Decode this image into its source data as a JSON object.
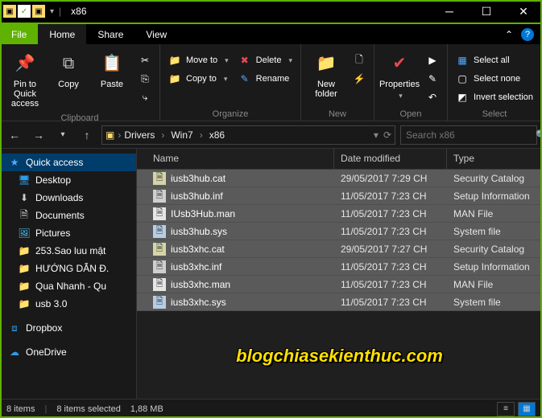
{
  "window": {
    "title": "x86"
  },
  "tabs": {
    "file": "File",
    "home": "Home",
    "share": "Share",
    "view": "View"
  },
  "ribbon": {
    "clipboard": {
      "pin": "Pin to Quick access",
      "copy": "Copy",
      "paste": "Paste",
      "label": "Clipboard"
    },
    "organize": {
      "moveto": "Move to",
      "copyto": "Copy to",
      "delete": "Delete",
      "rename": "Rename",
      "label": "Organize"
    },
    "new": {
      "folder": "New folder",
      "label": "New"
    },
    "open": {
      "properties": "Properties",
      "label": "Open"
    },
    "select": {
      "all": "Select all",
      "none": "Select none",
      "invert": "Invert selection",
      "label": "Select"
    }
  },
  "breadcrumb": [
    "Drivers",
    "Win7",
    "x86"
  ],
  "search": {
    "placeholder": "Search x86"
  },
  "columns": {
    "name": "Name",
    "date": "Date modified",
    "type": "Type"
  },
  "sidebar": [
    {
      "label": "Quick access",
      "icon": "star",
      "color": "#55aaff",
      "class": "quick top"
    },
    {
      "label": "Desktop",
      "icon": "desktop",
      "color": "#2f9be8"
    },
    {
      "label": "Downloads",
      "icon": "download",
      "color": "#cfcfcf"
    },
    {
      "label": "Documents",
      "icon": "doc",
      "color": "#e6e6e6"
    },
    {
      "label": "Pictures",
      "icon": "pic",
      "color": "#4fc3f7"
    },
    {
      "label": "253.Sao luu mật",
      "icon": "folder",
      "color": "#ffd96b"
    },
    {
      "label": "HƯỚNG DẪN Đ.",
      "icon": "folder",
      "color": "#ffd96b"
    },
    {
      "label": "Qua Nhanh - Qu",
      "icon": "folder",
      "color": "#ffd96b"
    },
    {
      "label": "usb 3.0",
      "icon": "folder",
      "color": "#ffd96b"
    },
    {
      "label": "Dropbox",
      "icon": "dropbox",
      "color": "#2f9be8",
      "class": "top",
      "gap": true
    },
    {
      "label": "OneDrive",
      "icon": "cloud",
      "color": "#2f9be8",
      "class": "top",
      "gap": true
    }
  ],
  "files": [
    {
      "name": "iusb3hub.cat",
      "date": "29/05/2017 7:29 CH",
      "type": "Security Catalog",
      "icon": "cat"
    },
    {
      "name": "iusb3hub.inf",
      "date": "11/05/2017 7:23 CH",
      "type": "Setup Information",
      "icon": "inf"
    },
    {
      "name": "IUsb3Hub.man",
      "date": "11/05/2017 7:23 CH",
      "type": "MAN File",
      "icon": "man"
    },
    {
      "name": "iusb3hub.sys",
      "date": "11/05/2017 7:23 CH",
      "type": "System file",
      "icon": "sys"
    },
    {
      "name": "iusb3xhc.cat",
      "date": "29/05/2017 7:27 CH",
      "type": "Security Catalog",
      "icon": "cat"
    },
    {
      "name": "iusb3xhc.inf",
      "date": "11/05/2017 7:23 CH",
      "type": "Setup Information",
      "icon": "inf"
    },
    {
      "name": "iusb3xhc.man",
      "date": "11/05/2017 7:23 CH",
      "type": "MAN File",
      "icon": "man"
    },
    {
      "name": "iusb3xhc.sys",
      "date": "11/05/2017 7:23 CH",
      "type": "System file",
      "icon": "sys"
    }
  ],
  "status": {
    "items": "8 items",
    "selected": "8 items selected",
    "size": "1,88 MB"
  },
  "watermark": "blogchiasekienthuc.com"
}
